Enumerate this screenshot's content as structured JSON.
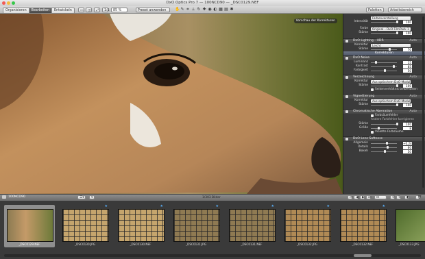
{
  "window": {
    "title": "DxO Optics Pro 7 — 100NCD90 — _DSC0129.NEF"
  },
  "toolbar": {
    "tabs": [
      {
        "label": "Organisieren",
        "active": false
      },
      {
        "label": "Bearbeiten",
        "active": true
      },
      {
        "label": "Entwickeln",
        "active": false
      }
    ],
    "zoom": "85 %",
    "preset": "Preset anwenden",
    "palettes_label": "Paletten",
    "workspace_label": "Arbeitsbereich"
  },
  "viewer": {
    "corrections_button": "Vorschau der Korrekturen"
  },
  "panel": {
    "top": {
      "rows": [
        {
          "label": "",
          "select": "Farbenverstellung"
        },
        {
          "label": "Intensität",
          "value": "100"
        },
        {
          "label": "Farbe",
          "select": "Original – DxO FilmPack 1"
        },
        {
          "label": "Stärke",
          "value": "100"
        }
      ]
    },
    "lighting": {
      "title": "DxO Lighting - HDR",
      "auto": "Auto",
      "korrektur_label": "Korrektur",
      "korrektur_value": "Leicht",
      "staerke_label": "Stärke",
      "staerke_value": "70"
    },
    "section_bar": "Korrekturen",
    "noise": {
      "title": "DxO Noise",
      "auto": "Auto",
      "rows": [
        {
          "label": "Luminanz",
          "value": "15"
        },
        {
          "label": "Kontrast",
          "value": "85"
        },
        {
          "label": "Farbigkeit",
          "value": "50"
        }
      ]
    },
    "distortion": {
      "title": "Verzeichnung",
      "auto": "Auto",
      "korrektur_label": "Korrektur",
      "korrektur_value": "Aus optischem DxO-Modul",
      "staerke_label": "Stärke",
      "staerke_value": "100",
      "checkbox": "Seitenverhältnis beibehalten"
    },
    "vignetting": {
      "title": "Vignettierung",
      "auto": "Auto",
      "korrektur_label": "Korrektur",
      "korrektur_value": "Aus optischem DxO-Modul",
      "staerke_label": "Stärke",
      "staerke_value": "100"
    },
    "chromatic": {
      "title": "Chromatische Aberration",
      "auto": "Auto",
      "fringe_label": "Farbsäumfehler",
      "sub_label": "Andere Farbfehler korrigieren",
      "staerke_label": "Stärke",
      "staerke_value": "100",
      "groesse_label": "Größe",
      "groesse_value": "8",
      "purple_label": "Violette Farbsäume"
    },
    "sharpness": {
      "title": "DxO Lens Softness",
      "rows": [
        {
          "label": "Allgemein",
          "value": "+0.24"
        },
        {
          "label": "Details",
          "value": "60"
        },
        {
          "label": "Bokeh",
          "value": "50"
        }
      ]
    }
  },
  "filmbar": {
    "folder": "100NCD90",
    "count": "1/303 Bilder"
  },
  "thumbnails": [
    {
      "caption": "_DSC0129.NEF",
      "selected": true
    },
    {
      "caption": "_DSC0130.JPG",
      "selected": false
    },
    {
      "caption": "_DSC0130.NEF",
      "selected": false
    },
    {
      "caption": "_DSC0131.JPG",
      "selected": false
    },
    {
      "caption": "_DSC0131.NEF",
      "selected": false
    },
    {
      "caption": "_DSC0132.JPG",
      "selected": false
    },
    {
      "caption": "_DSC0132.NEF",
      "selected": false
    },
    {
      "caption": "_DSC0133.JPG",
      "selected": false
    }
  ]
}
